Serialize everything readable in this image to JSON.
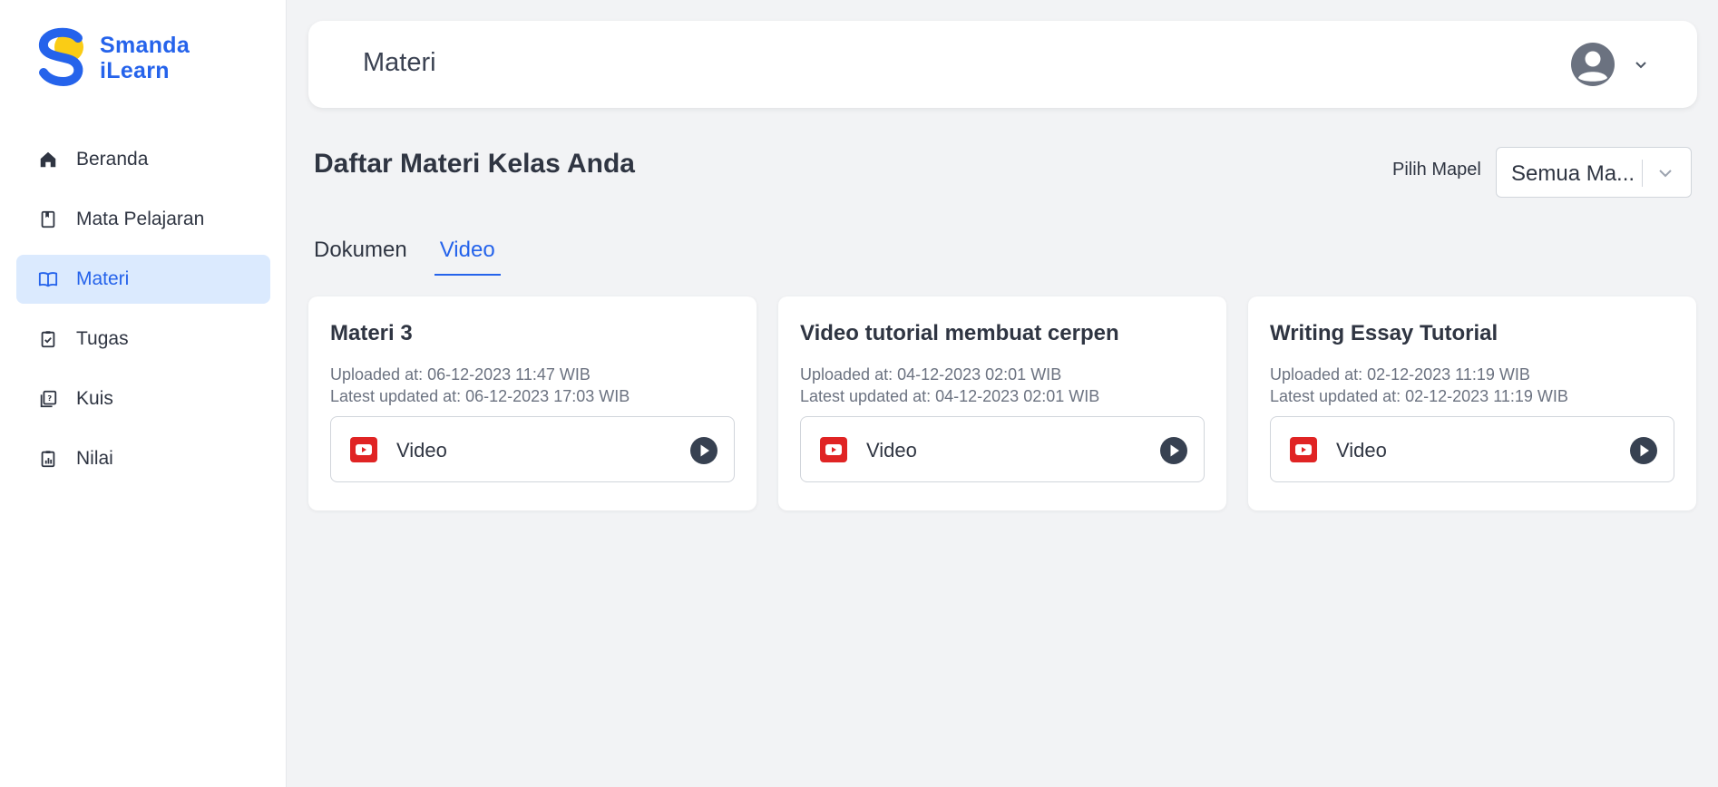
{
  "app": {
    "logo_line1": "Smanda",
    "logo_line2": "iLearn",
    "brand_color": "#2563eb",
    "accent_yellow": "#facc15"
  },
  "sidebar": {
    "items": [
      {
        "label": "Beranda",
        "icon": "home-icon"
      },
      {
        "label": "Mata Pelajaran",
        "icon": "book-icon"
      },
      {
        "label": "Materi",
        "icon": "open-book-icon",
        "active": true
      },
      {
        "label": "Tugas",
        "icon": "clipboard-check-icon"
      },
      {
        "label": "Kuis",
        "icon": "quiz-icon"
      },
      {
        "label": "Nilai",
        "icon": "grade-icon"
      }
    ]
  },
  "header": {
    "title": "Materi",
    "user_icon": "user-avatar-icon"
  },
  "main": {
    "title": "Daftar Materi Kelas Anda",
    "filter_label": "Pilih Mapel",
    "filter_value": "Semua Ma...",
    "tabs": [
      {
        "label": "Dokumen",
        "active": false
      },
      {
        "label": "Video",
        "active": true
      }
    ],
    "cards": [
      {
        "title": "Materi 3",
        "uploaded": "Uploaded at: 06-12-2023 11:47 WIB",
        "updated": "Latest updated at: 06-12-2023 17:03 WIB",
        "media_label": "Video"
      },
      {
        "title": "Video tutorial membuat cerpen",
        "uploaded": "Uploaded at: 04-12-2023 02:01 WIB",
        "updated": "Latest updated at: 04-12-2023 02:01 WIB",
        "media_label": "Video"
      },
      {
        "title": "Writing Essay Tutorial",
        "uploaded": "Uploaded at: 02-12-2023 11:19 WIB",
        "updated": "Latest updated at: 02-12-2023 11:19 WIB",
        "media_label": "Video"
      }
    ]
  },
  "colors": {
    "youtube_red": "#e02424",
    "play_dark": "#374151",
    "active_bg": "#dbeafe"
  }
}
